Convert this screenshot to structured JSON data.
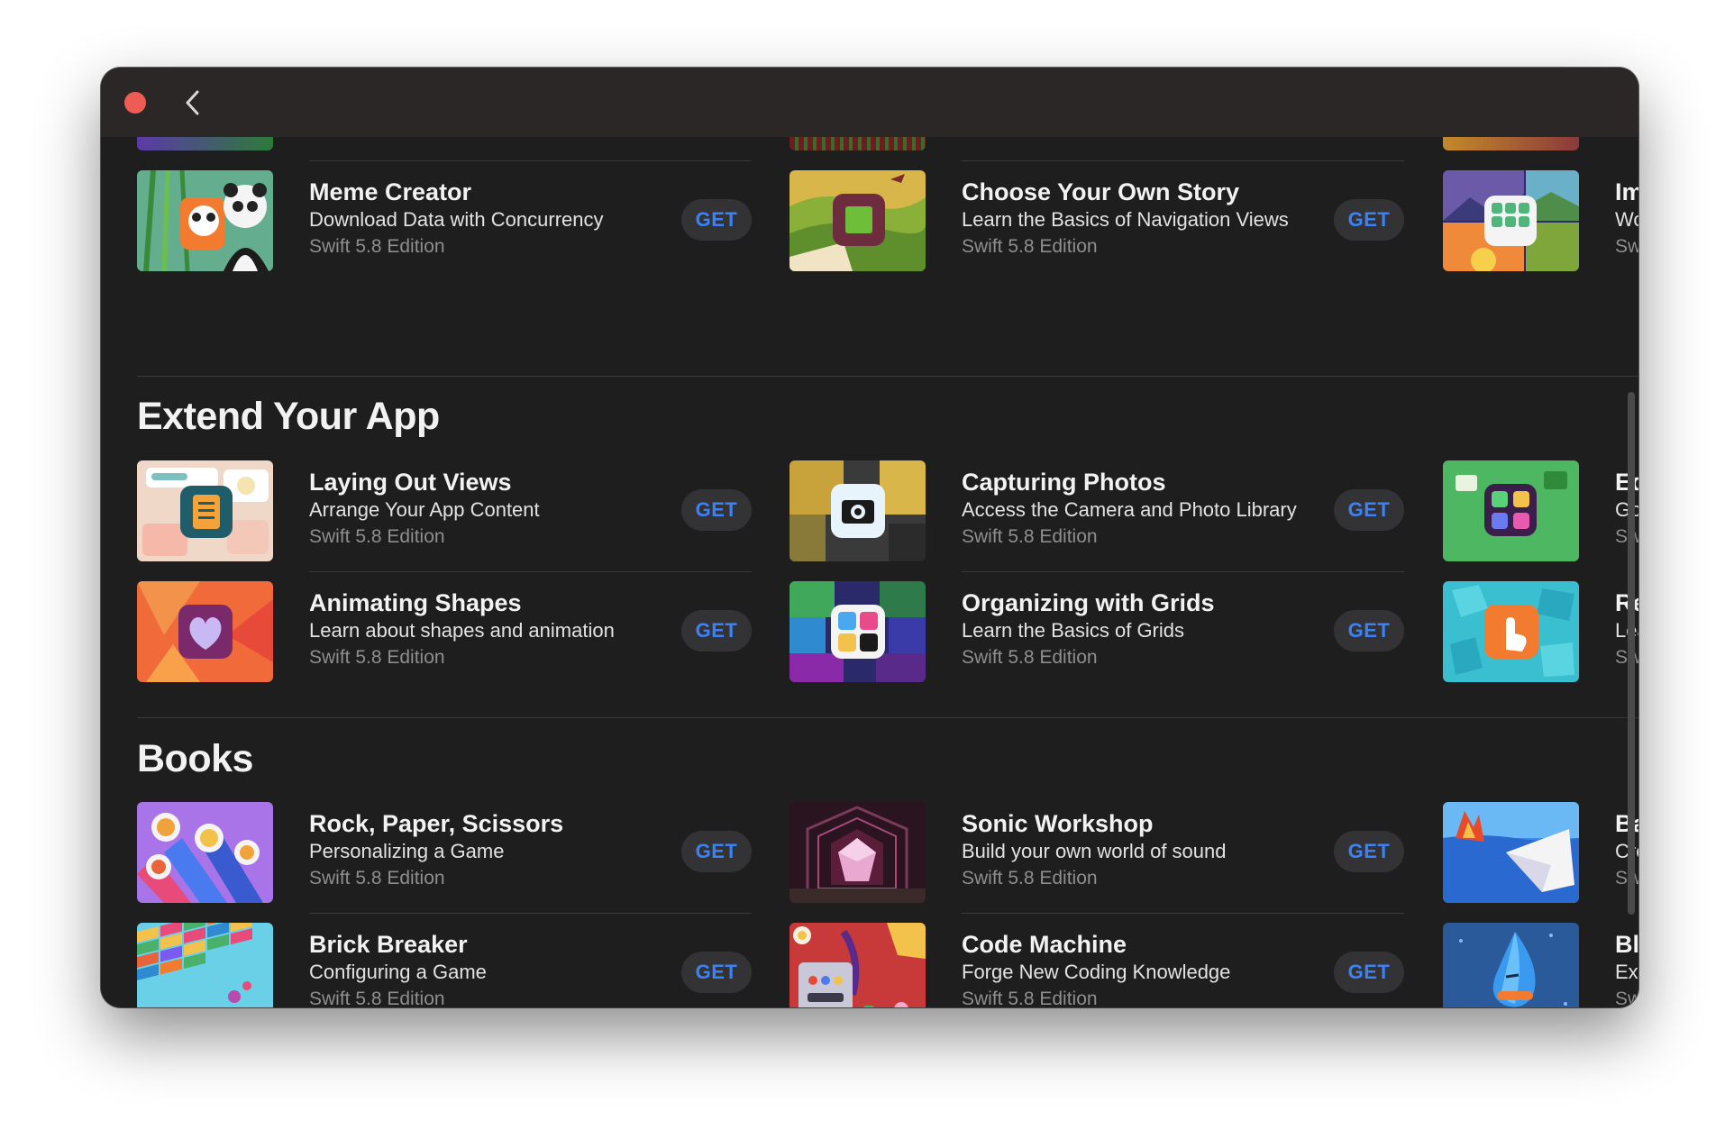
{
  "window": {
    "back_label": "back"
  },
  "sections": [
    {
      "title": "Extend Your App"
    },
    {
      "title": "Books"
    }
  ],
  "get_label": "GET",
  "rows": {
    "meme": {
      "title": "Meme Creator",
      "subtitle": "Download Data with Concurrency",
      "edition": "Swift 5.8 Edition"
    },
    "story": {
      "title": "Choose Your Own Story",
      "subtitle": "Learn the Basics of Navigation Views",
      "edition": "Swift 5.8 Edition"
    },
    "im": {
      "title": "Im",
      "subtitle": "Wo",
      "edition": "Sw"
    },
    "layout": {
      "title": "Laying Out Views",
      "subtitle": "Arrange Your App Content",
      "edition": "Swift 5.8 Edition"
    },
    "photos": {
      "title": "Capturing Photos",
      "subtitle": "Access the Camera and Photo Library",
      "edition": "Swift 5.8 Edition"
    },
    "ed": {
      "title": "Ed",
      "subtitle": "Go",
      "edition": "Sw"
    },
    "shapes": {
      "title": "Animating Shapes",
      "subtitle": "Learn about shapes and animation",
      "edition": "Swift 5.8 Edition"
    },
    "grids": {
      "title": "Organizing with Grids",
      "subtitle": "Learn the Basics of Grids",
      "edition": "Swift 5.8 Edition"
    },
    "re": {
      "title": "Re",
      "subtitle": "Lea",
      "edition": "Sw"
    },
    "rps": {
      "title": "Rock, Paper, Scissors",
      "subtitle": "Personalizing a Game",
      "edition": "Swift 5.8 Edition"
    },
    "sonic": {
      "title": "Sonic Workshop",
      "subtitle": "Build your own world of sound",
      "edition": "Swift 5.8 Edition"
    },
    "ba": {
      "title": "Ba",
      "subtitle": "Cre",
      "edition": "Sw"
    },
    "brick": {
      "title": "Brick Breaker",
      "subtitle": "Configuring a Game",
      "edition": "Swift 5.8 Edition"
    },
    "code": {
      "title": "Code Machine",
      "subtitle": "Forge New Coding Knowledge",
      "edition": "Swift 5.8 Edition"
    },
    "bl": {
      "title": "Bl",
      "subtitle": "Exp",
      "edition": "Sw"
    }
  },
  "colors": {
    "accent": "#3b82f6",
    "background": "#1e1e1e",
    "close": "#ee5c54"
  }
}
